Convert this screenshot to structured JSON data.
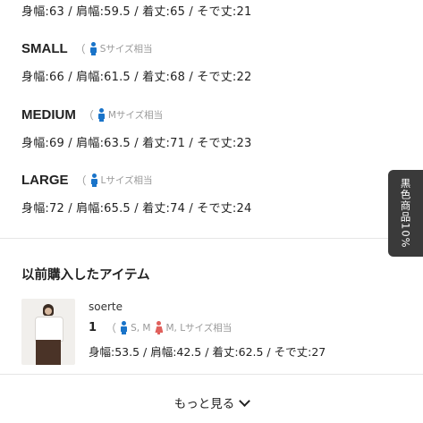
{
  "sizes": {
    "top_measure": "身幅:63 / 肩幅:59.5 / 着丈:65 / そで丈:21",
    "small": {
      "name": "SMALL",
      "paren": "（",
      "hint": "Sサイズ相当",
      "measure": "身幅:66 / 肩幅:61.5 / 着丈:68 / そで丈:22"
    },
    "medium": {
      "name": "MEDIUM",
      "paren": "（",
      "hint": "Mサイズ相当",
      "measure": "身幅:69 / 肩幅:63.5 / 着丈:71 / そで丈:23"
    },
    "large": {
      "name": "LARGE",
      "paren": "（",
      "hint": "Lサイズ相当",
      "measure": "身幅:72 / 肩幅:65.5 / 着丈:74 / そで丈:24"
    }
  },
  "purchased": {
    "title": "以前購入したアイテム",
    "item": {
      "brand": "soerte",
      "count": "1",
      "paren": "（",
      "size_a": "S, M",
      "size_b": "M, Lサイズ相当",
      "measure": "身幅:53.5 / 肩幅:42.5 / 着丈:62.5 / そで丈:27"
    },
    "more_label": "もっと見る"
  },
  "side_tab": {
    "label": "黒色商品10%"
  },
  "icons": {
    "male": "male-person-icon",
    "female": "female-person-icon",
    "more": "chevron-down-icon"
  },
  "colors": {
    "male_icon": "#1a74c9",
    "female_icon": "#e0605c",
    "side_tab_bg": "#3a3a3a"
  }
}
